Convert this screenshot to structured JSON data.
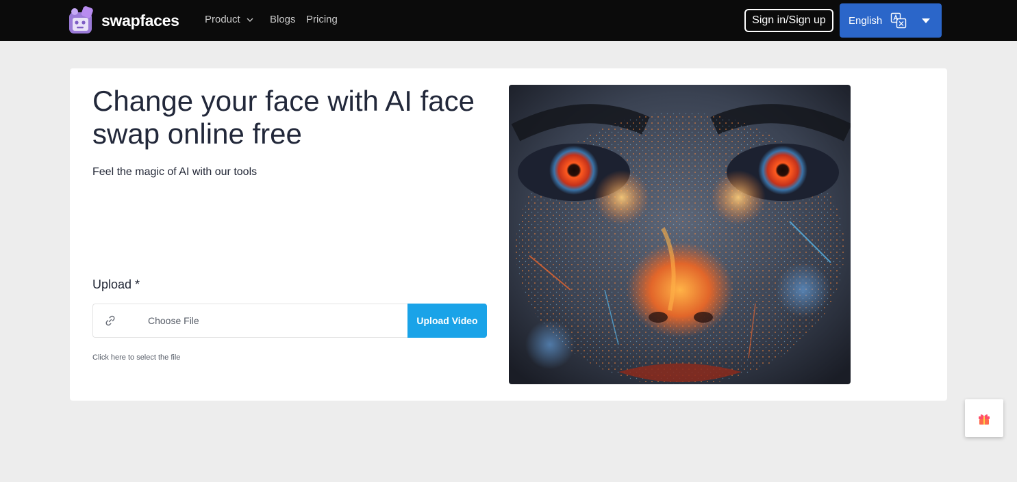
{
  "brand": {
    "name": "swapfaces"
  },
  "nav": {
    "product_label": "Product",
    "blogs_label": "Blogs",
    "pricing_label": "Pricing",
    "signin_label": "Sign in/Sign up",
    "language_label": "English"
  },
  "hero": {
    "title": "Change your face with AI face swap online free",
    "subtitle": "Feel the magic of AI with our tools"
  },
  "upload": {
    "label": "Upload *",
    "file_placeholder": "Choose File",
    "button_label": "Upload Video",
    "hint": "Click here to select the file"
  },
  "icons": {
    "logo": "swapfaces-logo-icon",
    "product_menu": "chevron-down-icon",
    "language": "translate-icon",
    "language_menu": "caret-down-icon",
    "file_link": "link-icon",
    "gift": "gift-icon"
  },
  "colors": {
    "nav_bg": "#0b0b0b",
    "language_button": "#2b66c9",
    "upload_button": "#1aa3e8",
    "page_bg": "#ededed"
  }
}
